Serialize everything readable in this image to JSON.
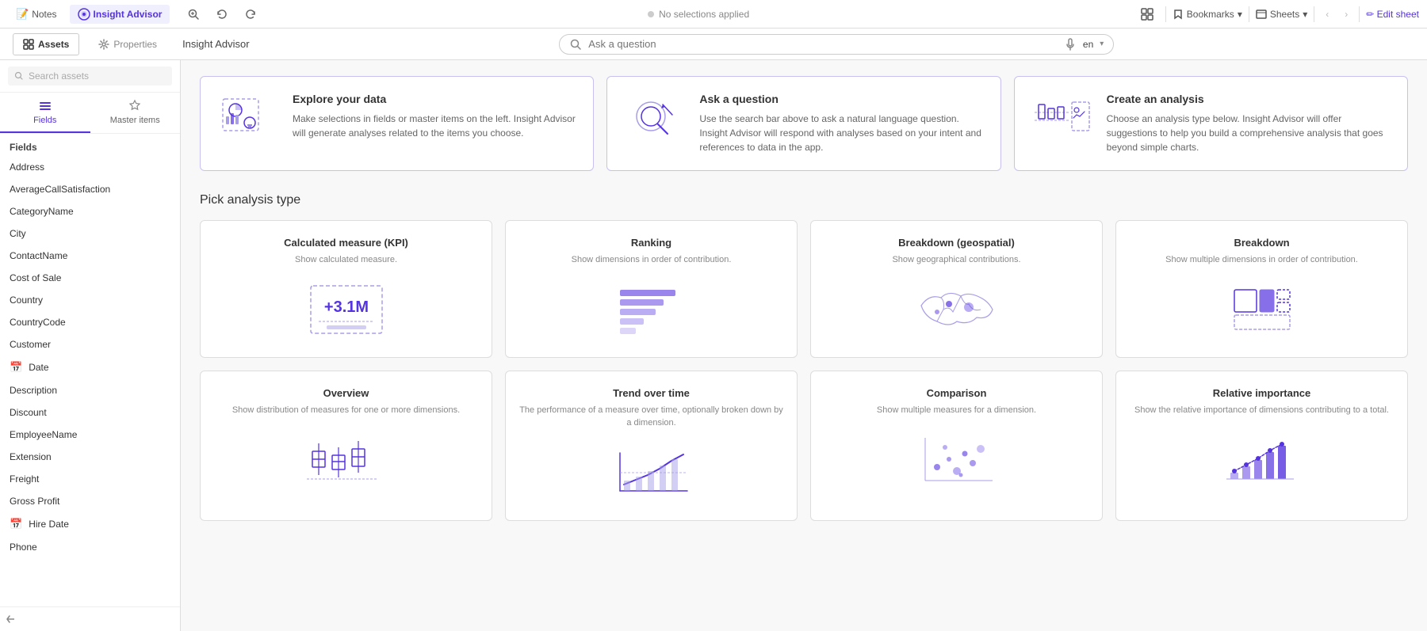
{
  "topbar": {
    "tabs": [
      {
        "id": "notes",
        "label": "Notes",
        "icon": "📝",
        "active": false
      },
      {
        "id": "insight-advisor",
        "label": "Insight Advisor",
        "icon": "🔮",
        "active": true
      }
    ],
    "selections_label": "No selections applied",
    "bookmarks_label": "Bookmarks",
    "sheets_label": "Sheets",
    "edit_sheet_label": "Edit sheet"
  },
  "secondbar": {
    "assets_label": "Assets",
    "properties_label": "Properties",
    "insight_label": "Insight Advisor",
    "search_placeholder": "Ask a question",
    "lang": "en"
  },
  "sidebar": {
    "search_placeholder": "Search assets",
    "tabs": [
      {
        "id": "fields",
        "label": "Fields",
        "icon": "≡",
        "active": true
      },
      {
        "id": "master-items",
        "label": "Master items",
        "icon": "⭐",
        "active": false
      }
    ],
    "fields_section": "Fields",
    "fields": [
      {
        "name": "Address",
        "icon": null
      },
      {
        "name": "AverageCallSatisfaction",
        "icon": null
      },
      {
        "name": "CategoryName",
        "icon": null
      },
      {
        "name": "City",
        "icon": null
      },
      {
        "name": "ContactName",
        "icon": null
      },
      {
        "name": "Cost of Sale",
        "icon": null
      },
      {
        "name": "Country",
        "icon": null
      },
      {
        "name": "CountryCode",
        "icon": null
      },
      {
        "name": "Customer",
        "icon": null
      },
      {
        "name": "Date",
        "icon": "📅"
      },
      {
        "name": "Description",
        "icon": null
      },
      {
        "name": "Discount",
        "icon": null
      },
      {
        "name": "EmployeeName",
        "icon": null
      },
      {
        "name": "Extension",
        "icon": null
      },
      {
        "name": "Freight",
        "icon": null
      },
      {
        "name": "Gross Profit",
        "icon": null
      },
      {
        "name": "Hire Date",
        "icon": "📅"
      },
      {
        "name": "Phone",
        "icon": null
      }
    ]
  },
  "main": {
    "explore_cards": [
      {
        "title": "Explore your data",
        "description": "Make selections in fields or master items on the left. Insight Advisor will generate analyses related to the items you choose."
      },
      {
        "title": "Ask a question",
        "description": "Use the search bar above to ask a natural language question. Insight Advisor will respond with analyses based on your intent and references to data in the app."
      },
      {
        "title": "Create an analysis",
        "description": "Choose an analysis type below. Insight Advisor will offer suggestions to help you build a comprehensive analysis that goes beyond simple charts."
      }
    ],
    "pick_analysis_title": "Pick analysis type",
    "analysis_types": [
      {
        "id": "calculated-measure",
        "title": "Calculated measure (KPI)",
        "description": "Show calculated measure.",
        "value": "+3.1M"
      },
      {
        "id": "ranking",
        "title": "Ranking",
        "description": "Show dimensions in order of contribution."
      },
      {
        "id": "breakdown-geospatial",
        "title": "Breakdown (geospatial)",
        "description": "Show geographical contributions."
      },
      {
        "id": "breakdown",
        "title": "Breakdown",
        "description": "Show multiple dimensions in order of contribution."
      },
      {
        "id": "overview",
        "title": "Overview",
        "description": "Show distribution of measures for one or more dimensions."
      },
      {
        "id": "trend-over-time",
        "title": "Trend over time",
        "description": "The performance of a measure over time, optionally broken down by a dimension."
      },
      {
        "id": "comparison",
        "title": "Comparison",
        "description": "Show multiple measures for a dimension."
      },
      {
        "id": "relative-importance",
        "title": "Relative importance",
        "description": "Show the relative importance of dimensions contributing to a total."
      }
    ]
  },
  "colors": {
    "accent": "#5533e0",
    "accent_light": "#c8c0f0",
    "border": "#ddd",
    "text_primary": "#333",
    "text_secondary": "#888",
    "chart_blue": "#4a3dd0",
    "chart_blue_light": "#a89ee8"
  }
}
